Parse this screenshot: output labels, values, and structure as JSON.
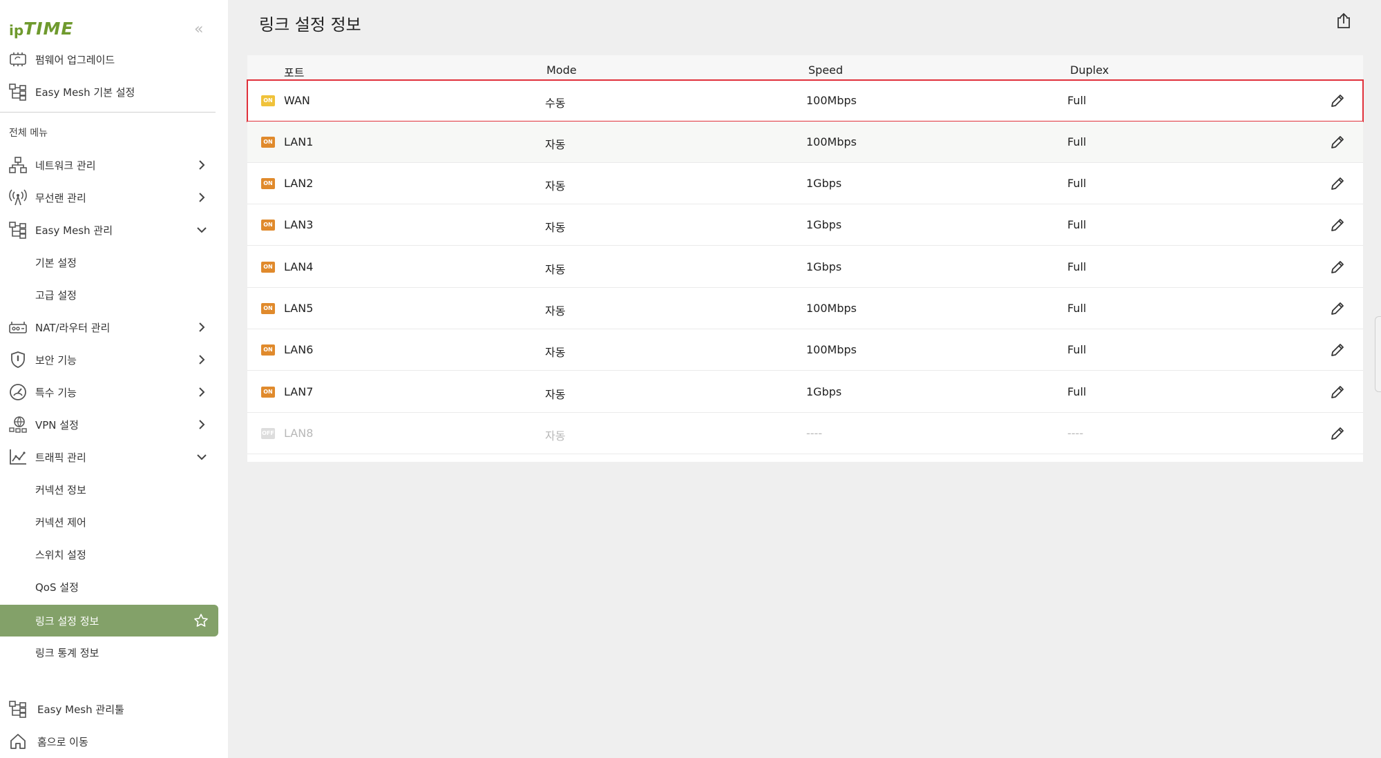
{
  "brand": {
    "ip": "ip",
    "time": "TIME"
  },
  "sidebar": {
    "collapse_glyph": "«",
    "quick": [
      {
        "label": "펌웨어 업그레이드",
        "icon": "firmware-icon"
      },
      {
        "label": "Easy Mesh 기본 설정",
        "icon": "mesh-icon"
      }
    ],
    "section_label": "전체 메뉴",
    "menu": [
      {
        "label": "네트워크 관리",
        "icon": "network-icon"
      },
      {
        "label": "무선랜 관리",
        "icon": "wireless-icon"
      },
      {
        "label": "Easy Mesh 관리",
        "icon": "mesh-icon",
        "expanded": true
      },
      {
        "label": "기본 설정",
        "sub": true
      },
      {
        "label": "고급 설정",
        "sub": true
      },
      {
        "label": "NAT/라우터 관리",
        "icon": "router-icon"
      },
      {
        "label": "보안 기능",
        "icon": "shield-icon"
      },
      {
        "label": "특수 기능",
        "icon": "gauge-icon"
      },
      {
        "label": "VPN 설정",
        "icon": "vpn-icon"
      },
      {
        "label": "트래픽 관리",
        "icon": "traffic-chart-icon",
        "expanded": true
      },
      {
        "label": "커넥션 정보",
        "sub": true
      },
      {
        "label": "커넥션 제어",
        "sub": true
      },
      {
        "label": "스위치 설정",
        "sub": true
      },
      {
        "label": "QoS 설정",
        "sub": true
      },
      {
        "label": "링크 설정 정보",
        "sub": true,
        "active": true
      },
      {
        "label": "링크 통계 정보",
        "sub": true
      }
    ],
    "bottom": [
      {
        "label": "Easy Mesh 관리툴",
        "icon": "mesh-icon"
      },
      {
        "label": "홈으로 이동",
        "icon": "home-icon"
      }
    ]
  },
  "page": {
    "title": "링크 설정 정보"
  },
  "table": {
    "headers": {
      "port": "포트",
      "mode": "Mode",
      "speed": "Speed",
      "duplex": "Duplex"
    },
    "rows": [
      {
        "port": "WAN",
        "status": "ON",
        "mode": "수동",
        "speed": "100Mbps",
        "duplex": "Full",
        "color": "#f0c23a",
        "highlight": true
      },
      {
        "port": "LAN1",
        "status": "ON",
        "mode": "자동",
        "speed": "100Mbps",
        "duplex": "Full",
        "color": "#e08a2c"
      },
      {
        "port": "LAN2",
        "status": "ON",
        "mode": "자동",
        "speed": "1Gbps",
        "duplex": "Full",
        "color": "#e08a2c"
      },
      {
        "port": "LAN3",
        "status": "ON",
        "mode": "자동",
        "speed": "1Gbps",
        "duplex": "Full",
        "color": "#e08a2c"
      },
      {
        "port": "LAN4",
        "status": "ON",
        "mode": "자동",
        "speed": "1Gbps",
        "duplex": "Full",
        "color": "#e08a2c"
      },
      {
        "port": "LAN5",
        "status": "ON",
        "mode": "자동",
        "speed": "100Mbps",
        "duplex": "Full",
        "color": "#e08a2c"
      },
      {
        "port": "LAN6",
        "status": "ON",
        "mode": "자동",
        "speed": "100Mbps",
        "duplex": "Full",
        "color": "#e08a2c"
      },
      {
        "port": "LAN7",
        "status": "ON",
        "mode": "자동",
        "speed": "1Gbps",
        "duplex": "Full",
        "color": "#e08a2c"
      },
      {
        "port": "LAN8",
        "status": "OFF",
        "mode": "자동",
        "speed": "----",
        "duplex": "----",
        "color": "#dddddd",
        "off": true
      }
    ]
  },
  "colors": {
    "brand": "#6f9a2e",
    "active_bg": "#83a169",
    "highlight_border": "#e0303a"
  }
}
